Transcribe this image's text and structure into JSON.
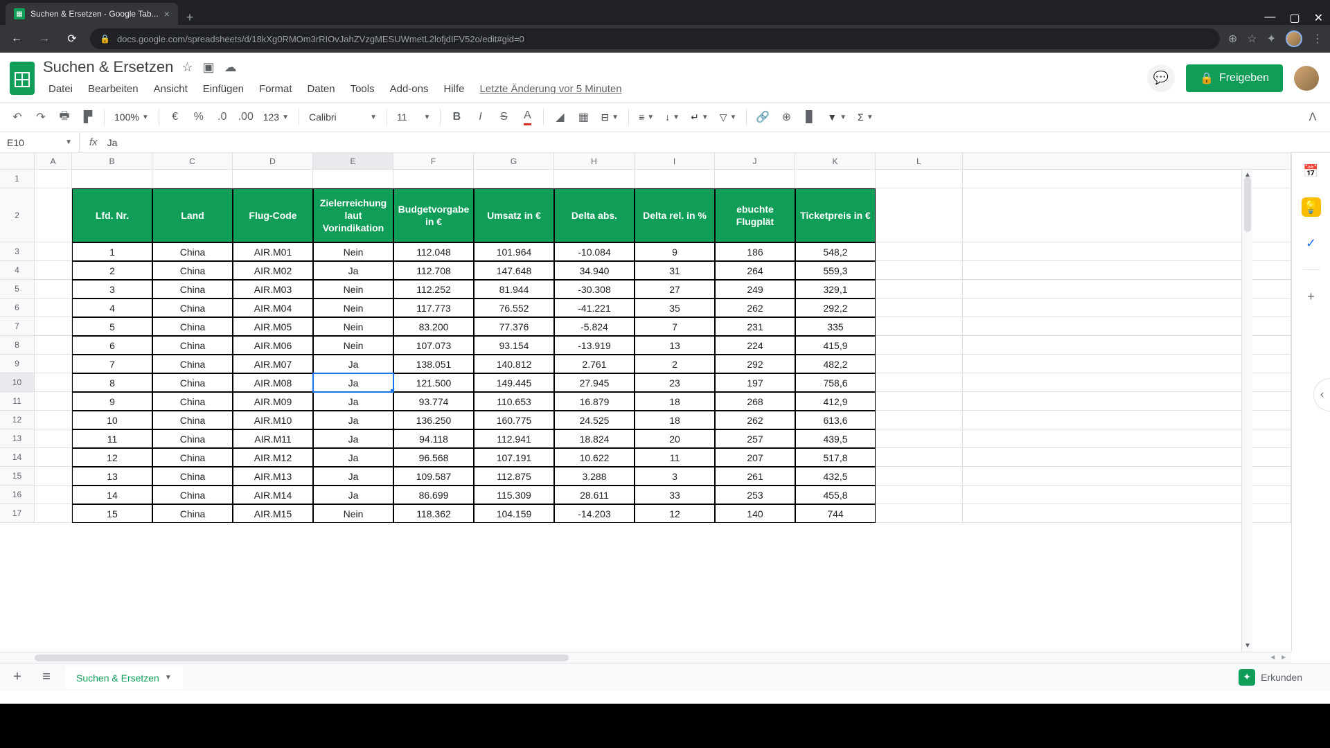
{
  "browser": {
    "tab_title": "Suchen & Ersetzen - Google Tab...",
    "url": "docs.google.com/spreadsheets/d/18kXg0RMOm3rRIOvJahZVzgMESUWmetL2lofjdIFV52o/edit#gid=0"
  },
  "doc": {
    "title": "Suchen & Ersetzen",
    "last_edit": "Letzte Änderung vor 5 Minuten"
  },
  "menu": [
    "Datei",
    "Bearbeiten",
    "Ansicht",
    "Einfügen",
    "Format",
    "Daten",
    "Tools",
    "Add-ons",
    "Hilfe"
  ],
  "toolbar": {
    "zoom": "100%",
    "number_format": "123",
    "font": "Calibri",
    "font_size": "11"
  },
  "share_label": "Freigeben",
  "name_box": "E10",
  "formula_value": "Ja",
  "columns": [
    "A",
    "B",
    "C",
    "D",
    "E",
    "F",
    "G",
    "H",
    "I",
    "J",
    "K",
    "L"
  ],
  "headers": {
    "B": "Lfd. Nr.",
    "C": "Land",
    "D": "Flug-Code",
    "E": "Zielerreichung laut Vorindikation",
    "F": "Budgetvorgabe in €",
    "G": "Umsatz in €",
    "H": "Delta abs.",
    "I": "Delta rel. in %",
    "J": "ebuchte Flugplät",
    "K": "Ticketpreis in €"
  },
  "rows": [
    {
      "n": 3,
      "B": "1",
      "C": "China",
      "D": "AIR.M01",
      "E": "Nein",
      "F": "112.048",
      "G": "101.964",
      "H": "-10.084",
      "I": "9",
      "J": "186",
      "K": "548,2"
    },
    {
      "n": 4,
      "B": "2",
      "C": "China",
      "D": "AIR.M02",
      "E": "Ja",
      "F": "112.708",
      "G": "147.648",
      "H": "34.940",
      "I": "31",
      "J": "264",
      "K": "559,3"
    },
    {
      "n": 5,
      "B": "3",
      "C": "China",
      "D": "AIR.M03",
      "E": "Nein",
      "F": "112.252",
      "G": "81.944",
      "H": "-30.308",
      "I": "27",
      "J": "249",
      "K": "329,1"
    },
    {
      "n": 6,
      "B": "4",
      "C": "China",
      "D": "AIR.M04",
      "E": "Nein",
      "F": "117.773",
      "G": "76.552",
      "H": "-41.221",
      "I": "35",
      "J": "262",
      "K": "292,2"
    },
    {
      "n": 7,
      "B": "5",
      "C": "China",
      "D": "AIR.M05",
      "E": "Nein",
      "F": "83.200",
      "G": "77.376",
      "H": "-5.824",
      "I": "7",
      "J": "231",
      "K": "335"
    },
    {
      "n": 8,
      "B": "6",
      "C": "China",
      "D": "AIR.M06",
      "E": "Nein",
      "F": "107.073",
      "G": "93.154",
      "H": "-13.919",
      "I": "13",
      "J": "224",
      "K": "415,9"
    },
    {
      "n": 9,
      "B": "7",
      "C": "China",
      "D": "AIR.M07",
      "E": "Ja",
      "F": "138.051",
      "G": "140.812",
      "H": "2.761",
      "I": "2",
      "J": "292",
      "K": "482,2"
    },
    {
      "n": 10,
      "B": "8",
      "C": "China",
      "D": "AIR.M08",
      "E": "Ja",
      "F": "121.500",
      "G": "149.445",
      "H": "27.945",
      "I": "23",
      "J": "197",
      "K": "758,6"
    },
    {
      "n": 11,
      "B": "9",
      "C": "China",
      "D": "AIR.M09",
      "E": "Ja",
      "F": "93.774",
      "G": "110.653",
      "H": "16.879",
      "I": "18",
      "J": "268",
      "K": "412,9"
    },
    {
      "n": 12,
      "B": "10",
      "C": "China",
      "D": "AIR.M10",
      "E": "Ja",
      "F": "136.250",
      "G": "160.775",
      "H": "24.525",
      "I": "18",
      "J": "262",
      "K": "613,6"
    },
    {
      "n": 13,
      "B": "11",
      "C": "China",
      "D": "AIR.M11",
      "E": "Ja",
      "F": "94.118",
      "G": "112.941",
      "H": "18.824",
      "I": "20",
      "J": "257",
      "K": "439,5"
    },
    {
      "n": 14,
      "B": "12",
      "C": "China",
      "D": "AIR.M12",
      "E": "Ja",
      "F": "96.568",
      "G": "107.191",
      "H": "10.622",
      "I": "11",
      "J": "207",
      "K": "517,8"
    },
    {
      "n": 15,
      "B": "13",
      "C": "China",
      "D": "AIR.M13",
      "E": "Ja",
      "F": "109.587",
      "G": "112.875",
      "H": "3.288",
      "I": "3",
      "J": "261",
      "K": "432,5"
    },
    {
      "n": 16,
      "B": "14",
      "C": "China",
      "D": "AIR.M14",
      "E": "Ja",
      "F": "86.699",
      "G": "115.309",
      "H": "28.611",
      "I": "33",
      "J": "253",
      "K": "455,8"
    },
    {
      "n": 17,
      "B": "15",
      "C": "China",
      "D": "AIR.M15",
      "E": "Nein",
      "F": "118.362",
      "G": "104.159",
      "H": "-14.203",
      "I": "12",
      "J": "140",
      "K": "744"
    }
  ],
  "sheet_tab": "Suchen & Ersetzen",
  "explore_label": "Erkunden",
  "selected_cell": {
    "row": 10,
    "col": "E"
  }
}
